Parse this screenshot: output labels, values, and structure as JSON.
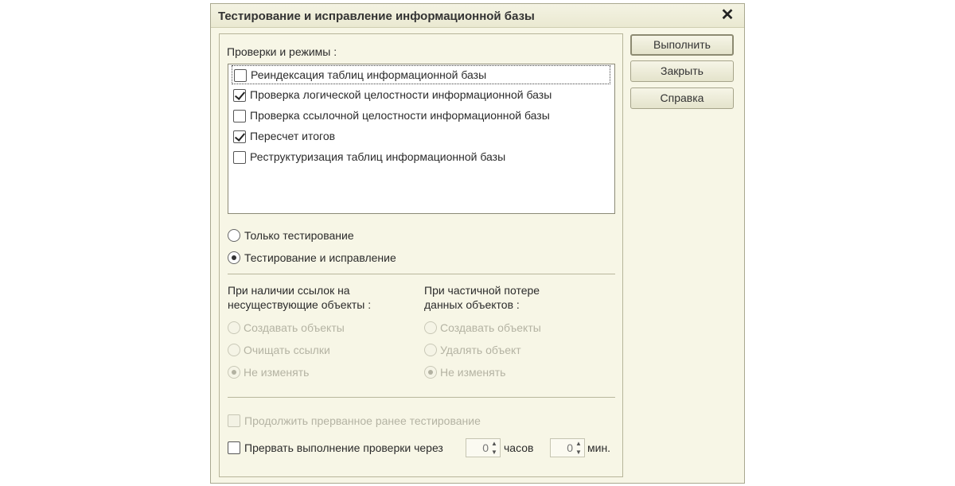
{
  "window": {
    "title": "Тестирование и исправление информационной базы",
    "close_symbol": "✕"
  },
  "checks": {
    "label": "Проверки и режимы :",
    "items": [
      {
        "label": "Реиндексация таблиц информационной базы",
        "checked": false
      },
      {
        "label": "Проверка логической целостности информационной базы",
        "checked": true
      },
      {
        "label": "Проверка ссылочной целостности информационной базы",
        "checked": false
      },
      {
        "label": "Пересчет итогов",
        "checked": true
      },
      {
        "label": "Реструктуризация таблиц информационной базы",
        "checked": false
      }
    ]
  },
  "mode": {
    "options": [
      {
        "label": "Только тестирование",
        "selected": false
      },
      {
        "label": "Тестирование и исправление",
        "selected": true
      }
    ]
  },
  "missing_refs": {
    "label_line1": "При наличии ссылок на",
    "label_line2": "несуществующие объекты :",
    "options": [
      {
        "label": "Создавать объекты",
        "selected": false
      },
      {
        "label": "Очищать ссылки",
        "selected": false
      },
      {
        "label": "Не изменять",
        "selected": true
      }
    ]
  },
  "partial_loss": {
    "label_line1": "При частичной потере",
    "label_line2": "данных объектов :",
    "options": [
      {
        "label": "Создавать объекты",
        "selected": false
      },
      {
        "label": "Удалять объект",
        "selected": false
      },
      {
        "label": "Не изменять",
        "selected": true
      }
    ]
  },
  "continue_testing": {
    "label": "Продолжить прерванное ранее тестирование",
    "checked": false
  },
  "interrupt": {
    "label": "Прервать выполнение проверки через",
    "hours_value": "0",
    "hours_label": "часов",
    "minutes_value": "0",
    "minutes_label": "мин.",
    "checked": false
  },
  "buttons": {
    "run": "Выполнить",
    "close": "Закрыть",
    "help": "Справка"
  },
  "icons": {
    "spin": "spin-arrows-icon"
  },
  "colors": {
    "background": "#f7f6e6",
    "border": "#a9a88f",
    "disabled_text": "#b4b3a3"
  }
}
